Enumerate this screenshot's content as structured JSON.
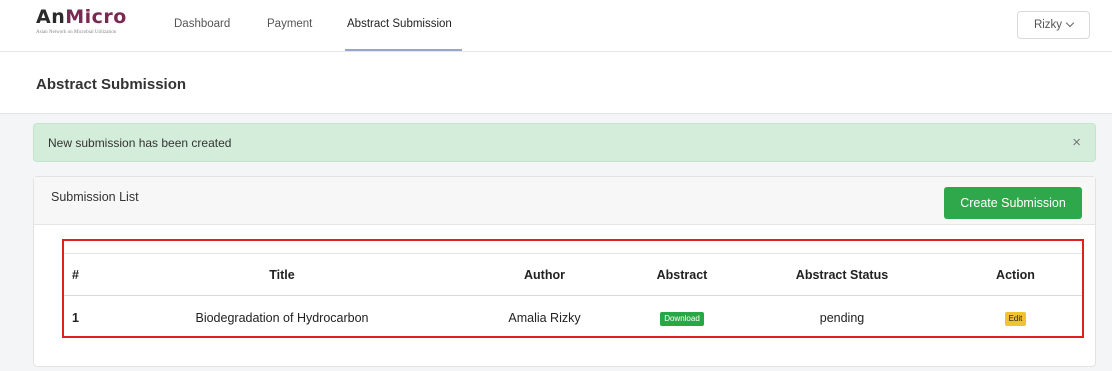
{
  "brand": {
    "logo_a": "An",
    "logo_b": "Micro",
    "tagline": "Asian Network on Microbial Utilization"
  },
  "nav": {
    "items": [
      {
        "label": "Dashboard"
      },
      {
        "label": "Payment"
      },
      {
        "label": "Abstract Submission"
      }
    ],
    "user": "Rizky"
  },
  "page": {
    "title": "Abstract Submission"
  },
  "alert": {
    "message": "New submission has been created",
    "close": "×"
  },
  "card": {
    "title": "Submission List",
    "create_button": "Create Submission"
  },
  "table": {
    "columns": [
      "#",
      "Title",
      "Author",
      "Abstract",
      "Abstract Status",
      "Action"
    ],
    "rows": [
      {
        "num": "1",
        "title": "Biodegradation of Hydrocarbon",
        "author": "Amalia Rizky",
        "abstract": "Download",
        "status": "pending",
        "action": "Edit"
      }
    ]
  },
  "colors": {
    "success": "#2ea84a",
    "alert_bg": "#d4edda",
    "highlight": "#e02020",
    "edit": "#f1c232"
  }
}
